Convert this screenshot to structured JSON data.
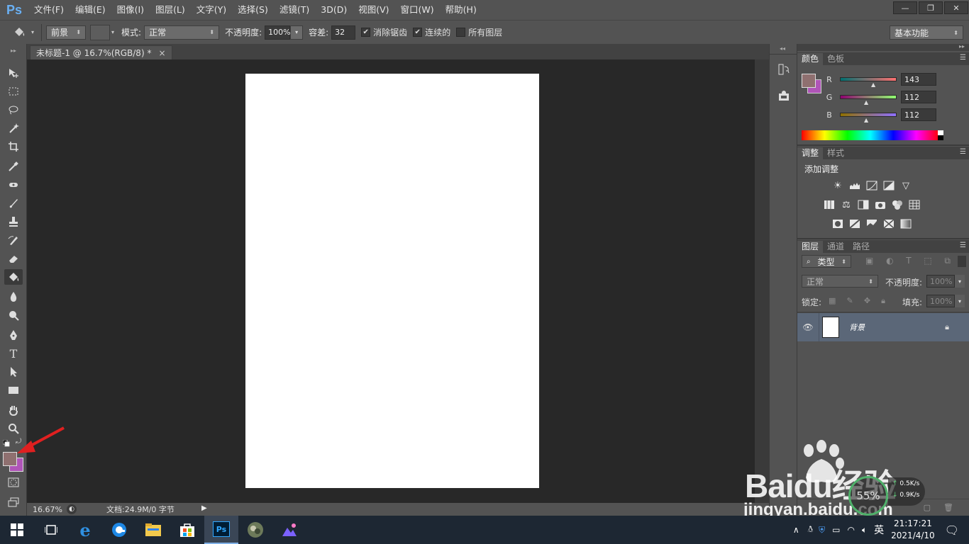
{
  "app": {
    "logo": "Ps"
  },
  "menubar": {
    "items": [
      "文件(F)",
      "编辑(E)",
      "图像(I)",
      "图层(L)",
      "文字(Y)",
      "选择(S)",
      "滤镜(T)",
      "3D(D)",
      "视图(V)",
      "窗口(W)",
      "帮助(H)"
    ]
  },
  "window_controls": {
    "minimize": "—",
    "restore": "❐",
    "close": "✕"
  },
  "options": {
    "fill_source": "前景",
    "mode_label": "模式:",
    "mode_value": "正常",
    "opacity_label": "不透明度:",
    "opacity_value": "100%",
    "tolerance_label": "容差:",
    "tolerance_value": "32",
    "antialias_label": "消除锯齿",
    "contiguous_label": "连续的",
    "all_layers_label": "所有图层",
    "workspace": "基本功能"
  },
  "document": {
    "tab_title": "未标题-1 @ 16.7%(RGB/8) *",
    "tab_close": "×",
    "zoom": "16.67%",
    "doc_info": "文档:24.9M/0 字节"
  },
  "color_panel": {
    "tabs": [
      "颜色",
      "色板"
    ],
    "channels": [
      {
        "label": "R",
        "value": "143"
      },
      {
        "label": "G",
        "value": "112"
      },
      {
        "label": "B",
        "value": "112"
      }
    ],
    "foreground": "#8f7070",
    "background": "#b055b8"
  },
  "adjust_panel": {
    "tabs": [
      "调整",
      "样式"
    ],
    "title": "添加调整"
  },
  "layers_panel": {
    "tabs": [
      "图层",
      "通道",
      "路径"
    ],
    "filter_label": "类型",
    "blend_mode": "正常",
    "opacity_label": "不透明度:",
    "opacity_value": "100%",
    "lock_label": "锁定:",
    "fill_label": "填充:",
    "fill_value": "100%",
    "layer_name": "背景"
  },
  "taskbar": {
    "time": "21:17:21",
    "date": "2021/4/10",
    "ime": "英",
    "ps_label": "Ps"
  },
  "watermark": {
    "brand": "Baidu经验",
    "url": "jingyan.baidu.com",
    "net_percent": "55%",
    "net_up": "0.5K/s",
    "net_down": "0.9K/s"
  }
}
